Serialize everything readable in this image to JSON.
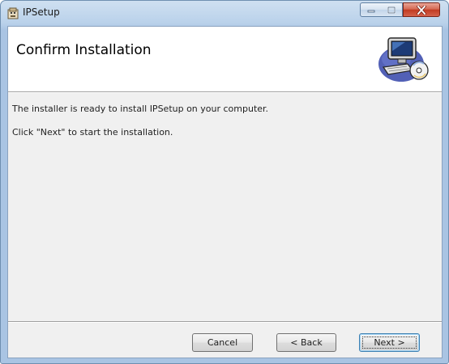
{
  "window": {
    "title": "IPSetup"
  },
  "banner": {
    "heading": "Confirm Installation",
    "graphic_icon": "computer-cd-icon"
  },
  "body": {
    "line1": "The installer is ready to install IPSetup on your computer.",
    "line2": "Click \"Next\" to start the installation."
  },
  "buttons": {
    "cancel": "Cancel",
    "back": "< Back",
    "next": "Next >"
  },
  "caption_buttons": {
    "minimize_icon": "minimize-icon",
    "maximize_icon": "maximize-icon",
    "close_icon": "close-icon"
  },
  "colors": {
    "titlebar": "#b9d1ea",
    "close_button": "#c23b22",
    "dialog_background": "#f0f0f0",
    "default_button_border": "#3c7fb1"
  }
}
